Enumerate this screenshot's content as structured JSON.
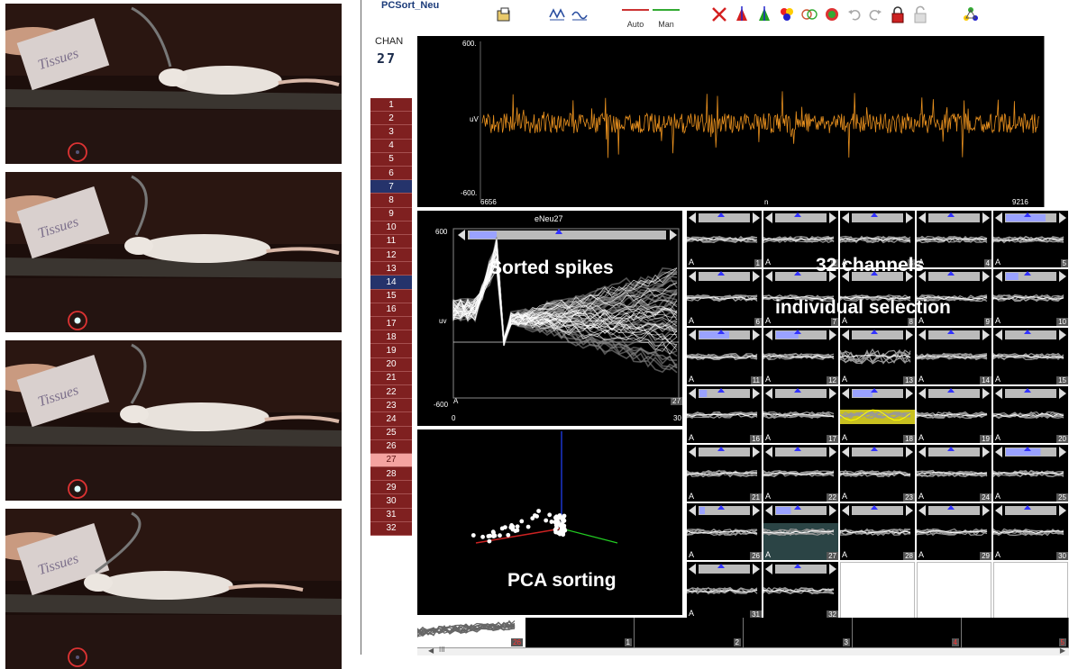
{
  "app": {
    "title": "PCSort_Neu",
    "auto_label": "Auto",
    "man_label": "Man",
    "chan_label": "CHAN",
    "chan_value": "27",
    "colors": {
      "channel": "#7f2020",
      "selected_blue": "#25336b",
      "current": "#f4a3a0",
      "waveform": "#e8901e"
    }
  },
  "channels": [
    "1",
    "2",
    "3",
    "4",
    "5",
    "6",
    "7",
    "8",
    "9",
    "10",
    "11",
    "12",
    "13",
    "14",
    "15",
    "16",
    "17",
    "18",
    "19",
    "20",
    "21",
    "22",
    "23",
    "24",
    "25",
    "26",
    "27",
    "28",
    "29",
    "30",
    "31",
    "32"
  ],
  "waveform": {
    "y_max": "600.",
    "y_unit": "uV",
    "y_min": "-600.",
    "x_start": "6656",
    "x_unit": "n",
    "x_end": "9216"
  },
  "sorted_panel": {
    "title": "eNeu27",
    "y_max": "600",
    "y_unit": "uv",
    "y_min": "-600",
    "x_start": "0",
    "x_end": "30",
    "unit": "A",
    "index": "27",
    "overlay": "Sorted spikes"
  },
  "pca_panel": {
    "overlay": "PCA sorting"
  },
  "grid_overlay": {
    "line1": "32 channels",
    "line2": "individual selection"
  },
  "grid_cells": [
    {
      "n": "1",
      "a": "A"
    },
    {
      "n": "2",
      "a": "A"
    },
    {
      "n": "3",
      "a": "A"
    },
    {
      "n": "4",
      "a": "A"
    },
    {
      "n": "5",
      "a": "A"
    },
    {
      "n": "6",
      "a": "A"
    },
    {
      "n": "7",
      "a": "A"
    },
    {
      "n": "8",
      "a": "A"
    },
    {
      "n": "9",
      "a": "A"
    },
    {
      "n": "10",
      "a": "A"
    },
    {
      "n": "11",
      "a": "A"
    },
    {
      "n": "12",
      "a": "A"
    },
    {
      "n": "13",
      "a": "A"
    },
    {
      "n": "14",
      "a": "A"
    },
    {
      "n": "15",
      "a": "A"
    },
    {
      "n": "16",
      "a": "A"
    },
    {
      "n": "17",
      "a": "A"
    },
    {
      "n": "18",
      "a": "A"
    },
    {
      "n": "19",
      "a": "A"
    },
    {
      "n": "20",
      "a": "A"
    },
    {
      "n": "21",
      "a": "A"
    },
    {
      "n": "22",
      "a": "A"
    },
    {
      "n": "23",
      "a": "A"
    },
    {
      "n": "24",
      "a": "A"
    },
    {
      "n": "25",
      "a": "A"
    },
    {
      "n": "26",
      "a": "A"
    },
    {
      "n": "27",
      "a": "A"
    },
    {
      "n": "28",
      "a": "A"
    },
    {
      "n": "29",
      "a": "A"
    },
    {
      "n": "30",
      "a": "A"
    },
    {
      "n": "31",
      "a": "A"
    },
    {
      "n": "32",
      "a": ""
    }
  ],
  "bottom_strip": [
    {
      "n": "26",
      "red": true
    },
    {
      "n": "1",
      "red": false
    },
    {
      "n": "2",
      "red": false
    },
    {
      "n": "3",
      "red": false
    },
    {
      "n": "4",
      "red": true
    },
    {
      "n": "5",
      "red": true
    }
  ],
  "bottom_scroll": {
    "marker": "III"
  },
  "video_frames": {
    "box_text": "Tissues"
  }
}
